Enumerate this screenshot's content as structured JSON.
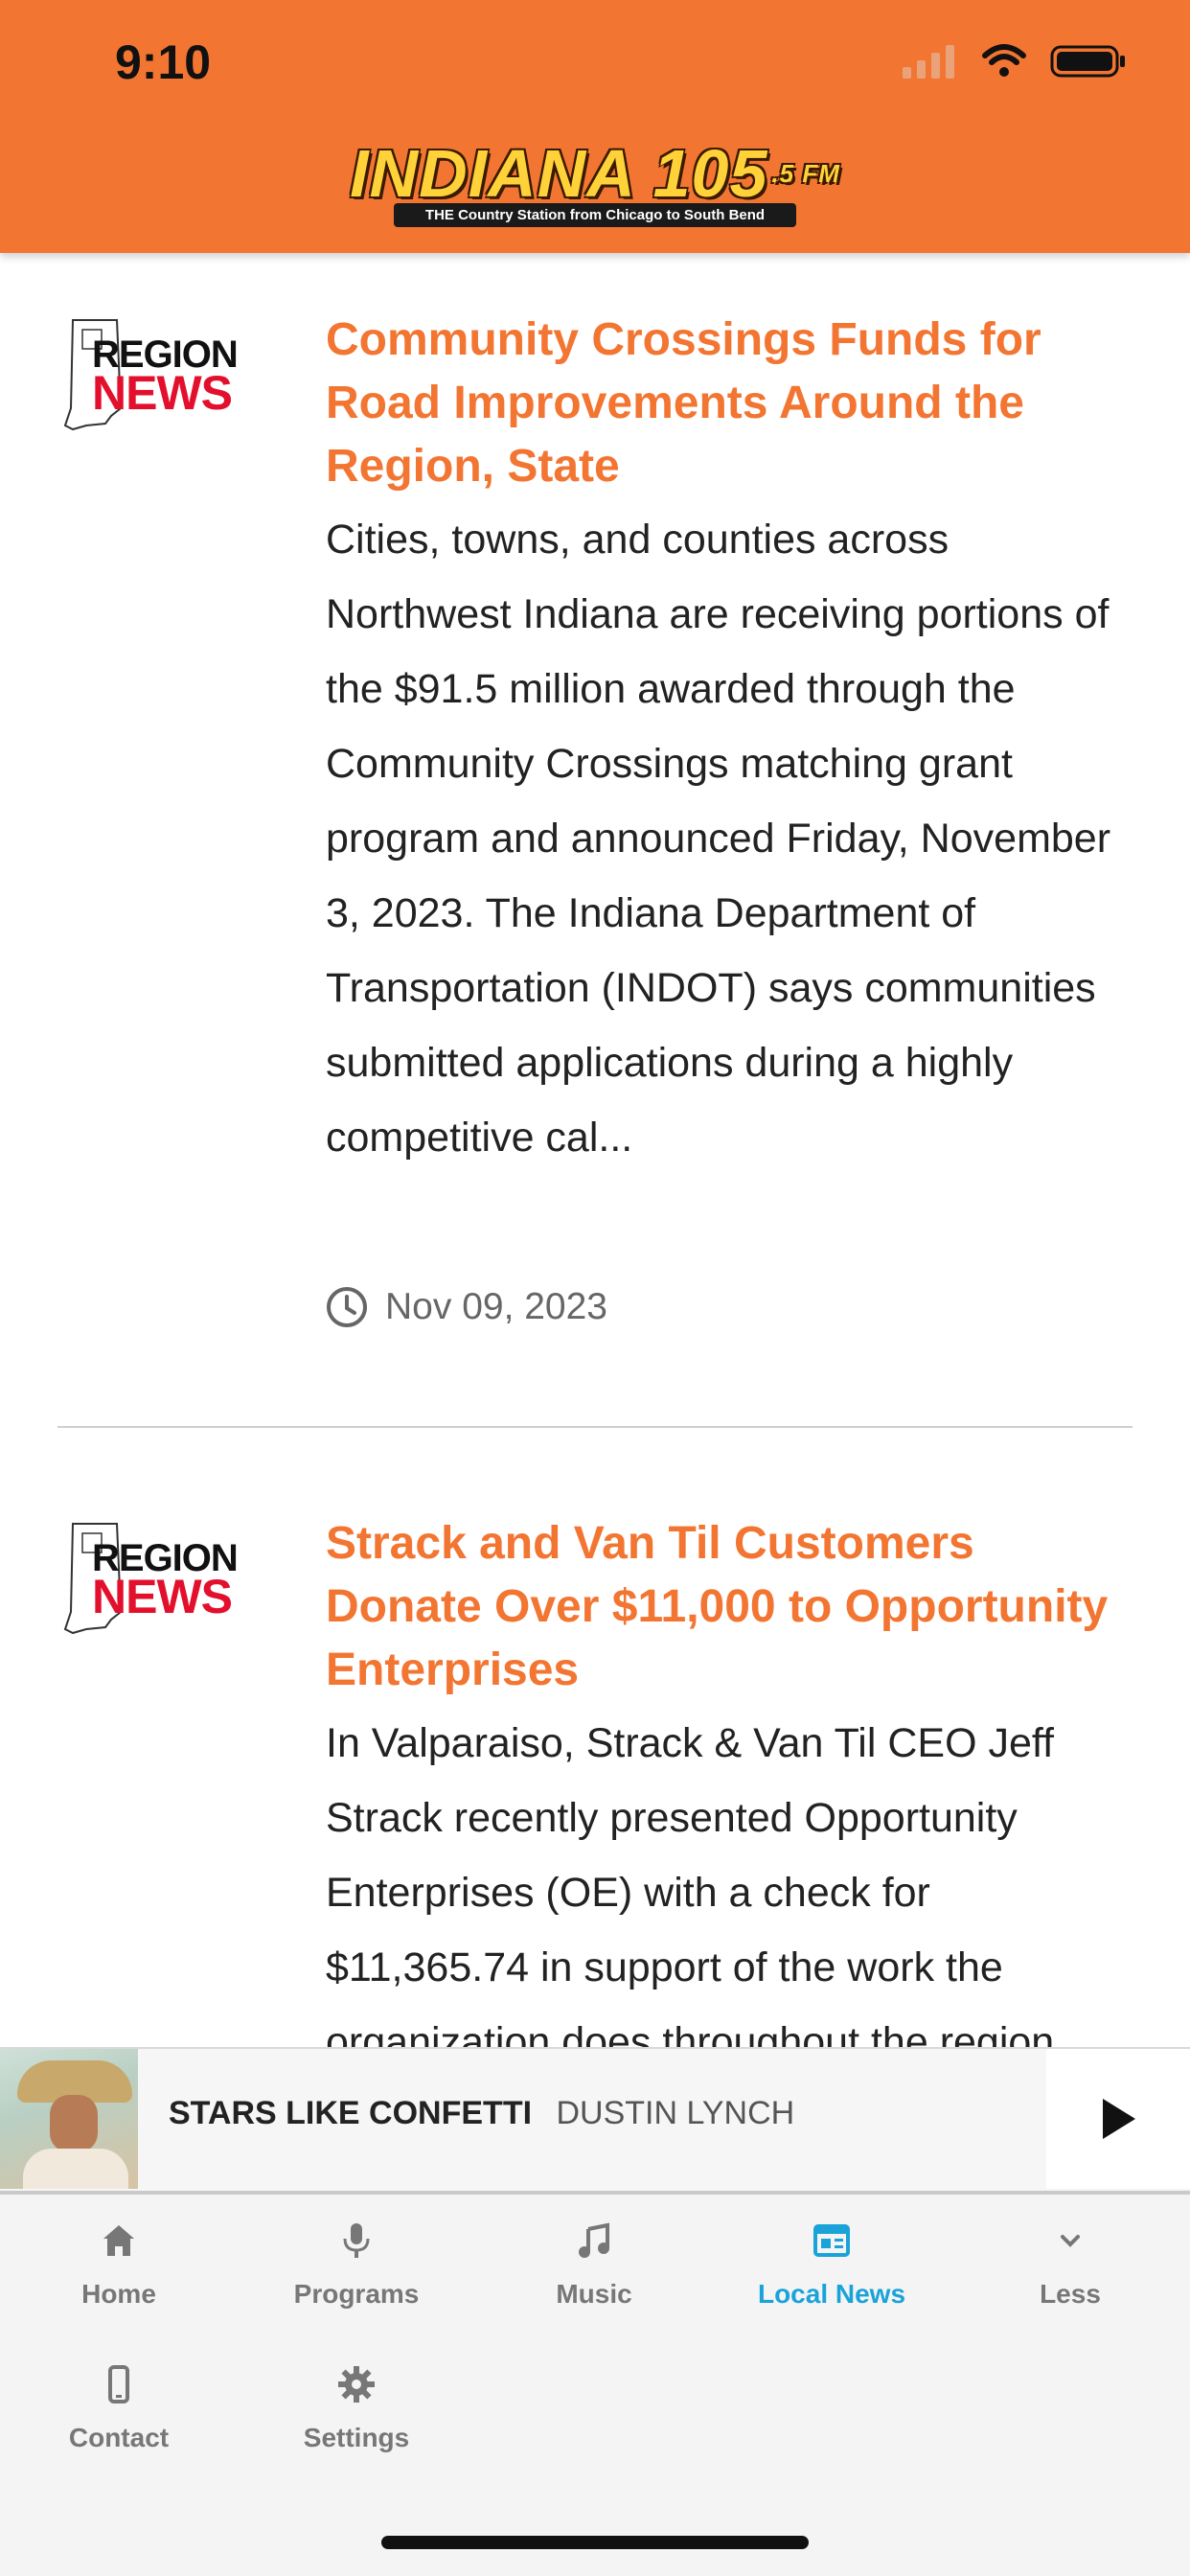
{
  "status_bar": {
    "time": "9:10"
  },
  "header": {
    "logo_main": "INDIANA 105",
    "logo_fm": ".5 FM",
    "logo_tagline": "THE Country Station from Chicago to South Bend"
  },
  "articles": [
    {
      "thumb_line1": "REGION",
      "thumb_line2": "NEWS",
      "title": "Community Crossings Funds for Road Improvements Around the Region, State",
      "summary": "Cities, towns, and counties across Northwest Indiana are receiving portions of the $91.5 million awarded through the Community Crossings matching grant program and announced Friday, November 3, 2023. The Indiana Department of Transportation (INDOT) says communities submitted applications during a highly competitive cal...",
      "date": "Nov 09, 2023"
    },
    {
      "thumb_line1": "REGION",
      "thumb_line2": "NEWS",
      "title": "Strack and Van Til Customers Donate Over $11,000 to Opportunity Enterprises",
      "summary": "In Valparaiso, Strack & Van Til CEO Jeff Strack recently presented Opportunity Enterprises (OE) with a check for $11,365.74 in support of the work the organization does throughout the region.",
      "date": ""
    }
  ],
  "player": {
    "track_title": "STARS LIKE CONFETTI",
    "track_artist": "DUSTIN LYNCH"
  },
  "tabs": [
    {
      "label": "Home",
      "icon": "home-icon",
      "active": false
    },
    {
      "label": "Programs",
      "icon": "microphone-icon",
      "active": false
    },
    {
      "label": "Music",
      "icon": "music-note-icon",
      "active": false
    },
    {
      "label": "Local News",
      "icon": "newspaper-icon",
      "active": true
    },
    {
      "label": "Less",
      "icon": "chevron-down-icon",
      "active": false
    },
    {
      "label": "Contact",
      "icon": "phone-icon",
      "active": false
    },
    {
      "label": "Settings",
      "icon": "gear-icon",
      "active": false
    }
  ],
  "colors": {
    "brand": "#f37532",
    "accent": "#1aa3d9",
    "news_red": "#e3102d"
  }
}
